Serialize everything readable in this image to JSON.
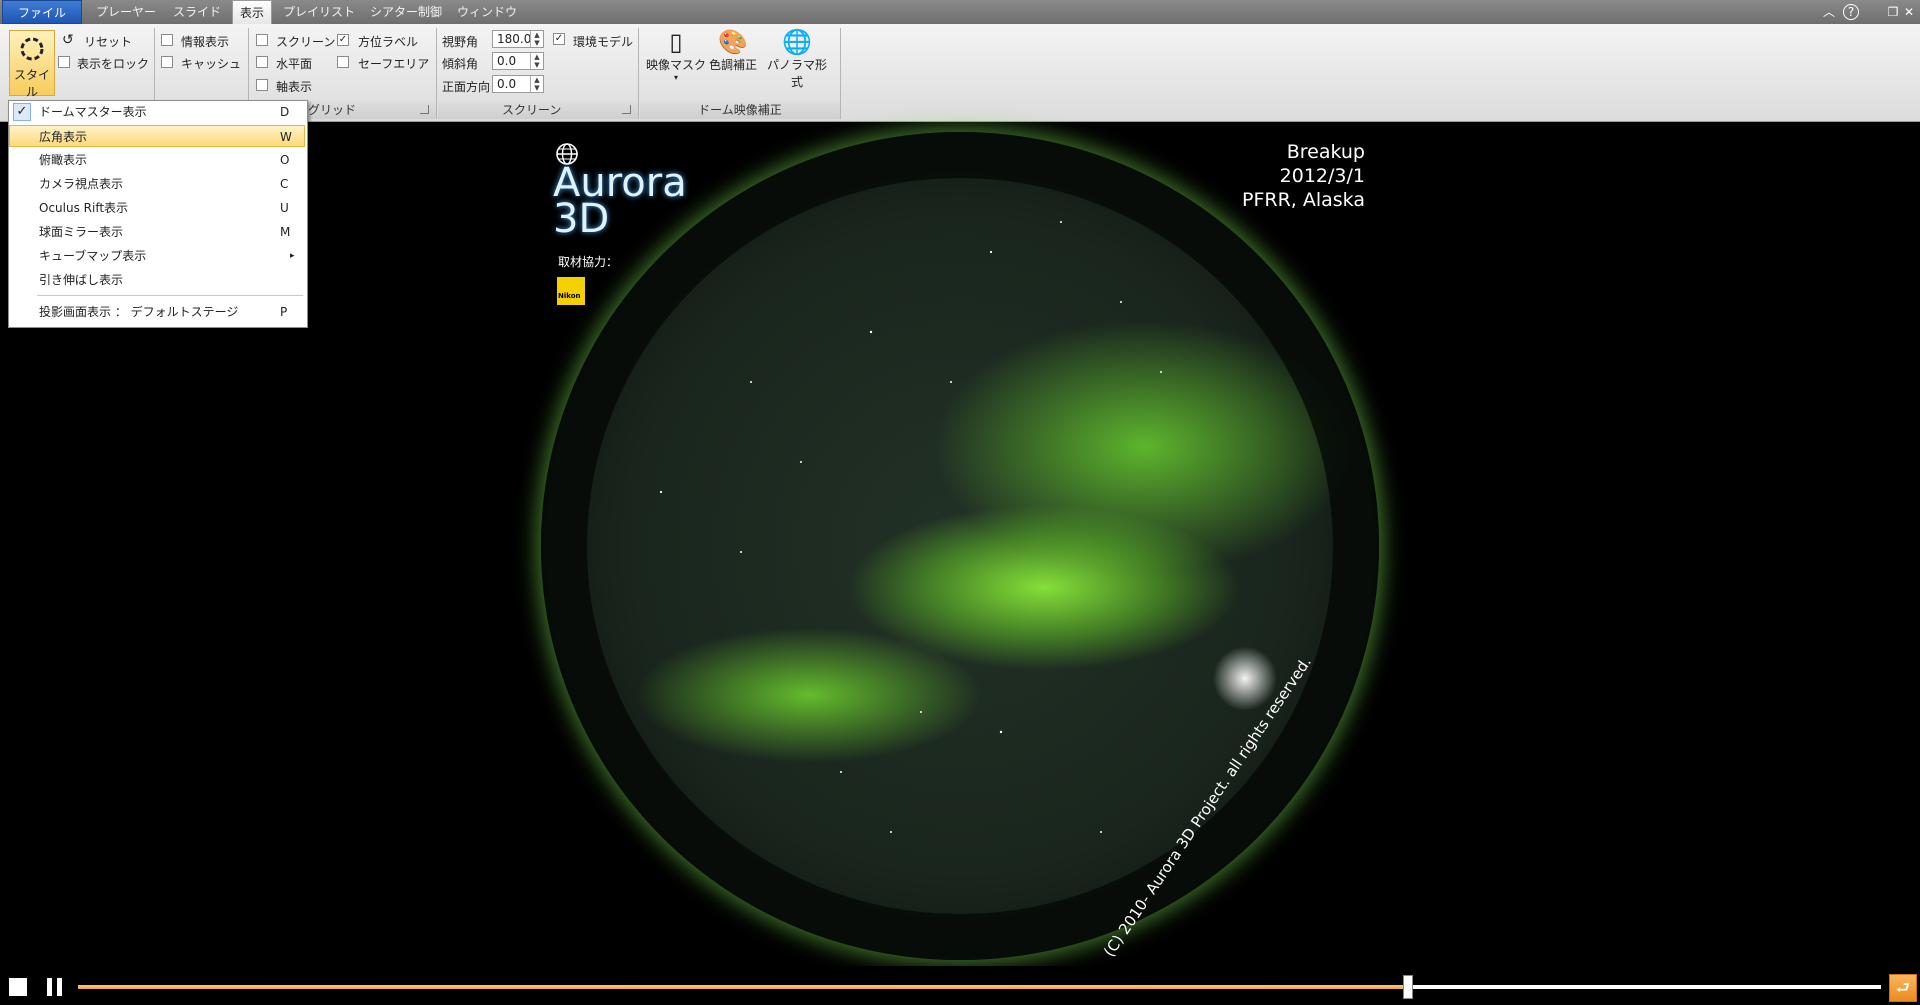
{
  "tabs": {
    "file": "ファイル",
    "player": "プレーヤー",
    "slide": "スライド",
    "view": "表示",
    "playlist": "プレイリスト",
    "theater": "シアター制御",
    "window": "ウィンドウ"
  },
  "window_controls": {
    "collapse": "︿",
    "help": "?",
    "restore": "❐",
    "close": "✕"
  },
  "ribbon": {
    "style_label": "スタイル",
    "reset_label": "リセット",
    "lock_view_label": "表示をロック",
    "info_label": "情報表示",
    "cache_label": "キャッシュ",
    "screen_label": "スクリーン",
    "horizon_label": "水平面",
    "axis_label": "軸表示",
    "direction_label": "方位ラベル",
    "safe_area_label": "セーフエリア",
    "grid_group": "グリッド",
    "fov_label": "視野角",
    "fov_value": "180.0",
    "tilt_label": "傾斜角",
    "tilt_value": "0.0",
    "front_label": "正面方向",
    "front_value": "0.0",
    "env_model_label": "環境モデル",
    "screen_group": "スクリーン",
    "mask_label": "映像マスク",
    "color_label": "色調補正",
    "panorama_label": "パノラマ形式",
    "dome_group": "ドーム映像補正"
  },
  "checkbox_states": {
    "lock_view": false,
    "info": false,
    "cache": false,
    "screen": false,
    "horizon": false,
    "axis": false,
    "direction": true,
    "safe_area": false,
    "env_model": true
  },
  "dropdown": {
    "items": [
      {
        "label": "ドームマスター表示",
        "key": "D",
        "checked": true
      },
      {
        "label": "広角表示",
        "key": "W",
        "highlighted": true
      },
      {
        "label": "俯瞰表示",
        "key": "O"
      },
      {
        "label": "カメラ視点表示",
        "key": "C"
      },
      {
        "label": "Oculus Rift表示",
        "key": "U"
      },
      {
        "label": "球面ミラー表示",
        "key": "M"
      },
      {
        "label": "キューブマップ表示",
        "key": "▸"
      },
      {
        "label": "引き伸ばし表示",
        "key": ""
      }
    ],
    "projection": {
      "label": "投影画面表示 ： デフォルトステージ",
      "key": "P"
    },
    "check_mark": "✓"
  },
  "stage": {
    "logo_line1": "Aurora",
    "logo_line2": "3D",
    "cooperation": "取材協力：",
    "sponsor_badge": "Nikon",
    "title": "Breakup",
    "date": "2012/3/1",
    "location": "PFRR, Alaska",
    "copyright": "(C) 2010- Aurora 3D Project. all rights reserved."
  },
  "player": {
    "progress": 0.7374
  },
  "colors": {
    "accent": "#f0a83a",
    "file_tab": "#2a63c2",
    "aurora": "#7cf03c"
  }
}
